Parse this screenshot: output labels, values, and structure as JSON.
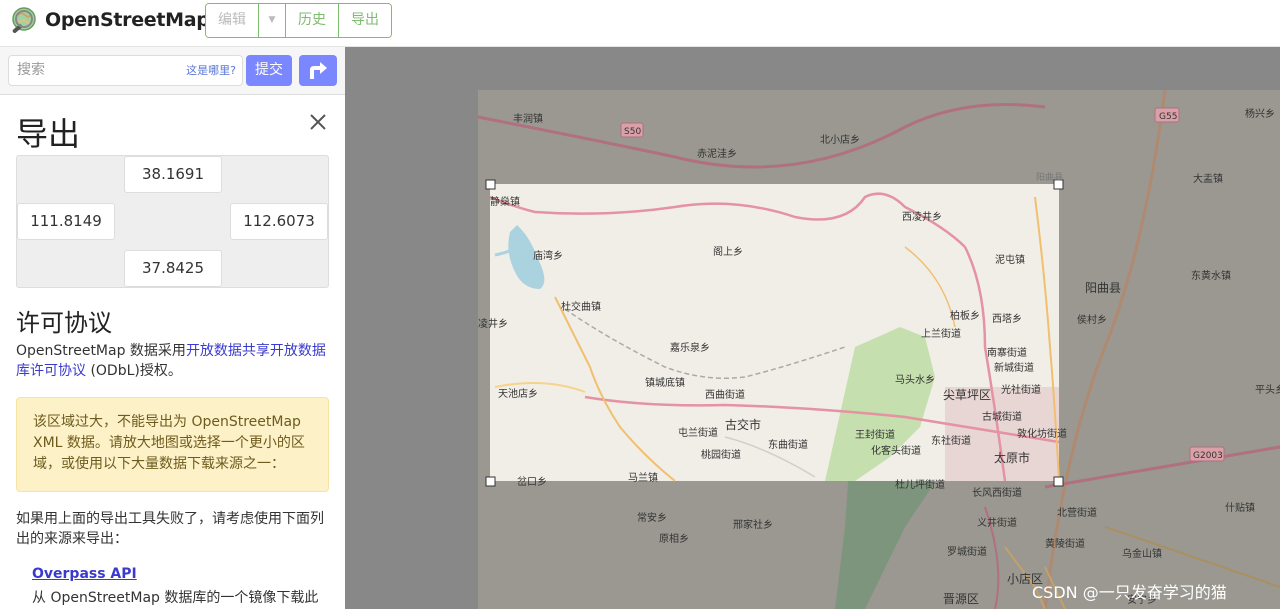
{
  "header": {
    "brand": "OpenStreetMap",
    "buttons": {
      "edit": "编辑",
      "history": "历史",
      "export": "导出"
    }
  },
  "search": {
    "placeholder": "搜索",
    "where_link": "这是哪里?",
    "submit": "提交"
  },
  "panel": {
    "title": "导出",
    "coords": {
      "north": "38.1691",
      "west": "111.8149",
      "east": "112.6073",
      "south": "37.8425"
    },
    "license_title": "许可协议",
    "license_text_1": "OpenStreetMap 数据采用",
    "license_link": "开放数据共享开放数据库许可协议",
    "license_text_2": " (ODbL)授权。",
    "alert": "该区域过大，不能导出为 OpenStreetMap XML 数据。请放大地图或选择一个更小的区域，或使用以下大量数据下载来源之一：",
    "fallback_text": "如果用上面的导出工具失败了，请考虑使用下面列出的来源来导出：",
    "overpass_title": "Overpass API",
    "overpass_desc": "从 OpenStreetMap 数据库的一个镜像下载此"
  },
  "map": {
    "labels": [
      "丰润镇",
      "S50",
      "赤泥洼乡",
      "北小店乡",
      "G55",
      "杨兴乡",
      "阳曲县",
      "阳曲县",
      "大盂镇",
      "静燊镇",
      "西凌井乡",
      "庙湾乡",
      "阁上乡",
      "泥屯镇",
      "东黄水镇",
      "杜交曲镇",
      "柏板乡",
      "西塔乡",
      "侯村乡",
      "上兰街道",
      "嘉乐泉乡",
      "凌井乡",
      "南寨街道",
      "新城街道",
      "马头水乡",
      "光社街道",
      "镇城底镇",
      "天池店乡",
      "西曲街道",
      "尖草坪区",
      "古城街道",
      "平头乡",
      "古交市",
      "屯兰街道",
      "东曲街道",
      "王封街道",
      "东社街道",
      "敦化坊街道",
      "化客头街道",
      "桃园街道",
      "太原市",
      "G2003",
      "马兰镇",
      "岔口乡",
      "杜儿坪街道",
      "长风西街道",
      "北营街道",
      "常安乡",
      "邢家社乡",
      "义井街道",
      "什贴镇",
      "原相乡",
      "黄陵街道",
      "罗城街道",
      "乌金山镇",
      "小店区",
      "晋源区",
      "安宁乡"
    ],
    "watermark": "CSDN @一只发奋学习的猫"
  },
  "colors": {
    "accent_green": "#7ebc6f",
    "button_blue": "#7a87ff",
    "link_blue": "#3a3acf",
    "alert_bg": "#fdf1c8"
  }
}
